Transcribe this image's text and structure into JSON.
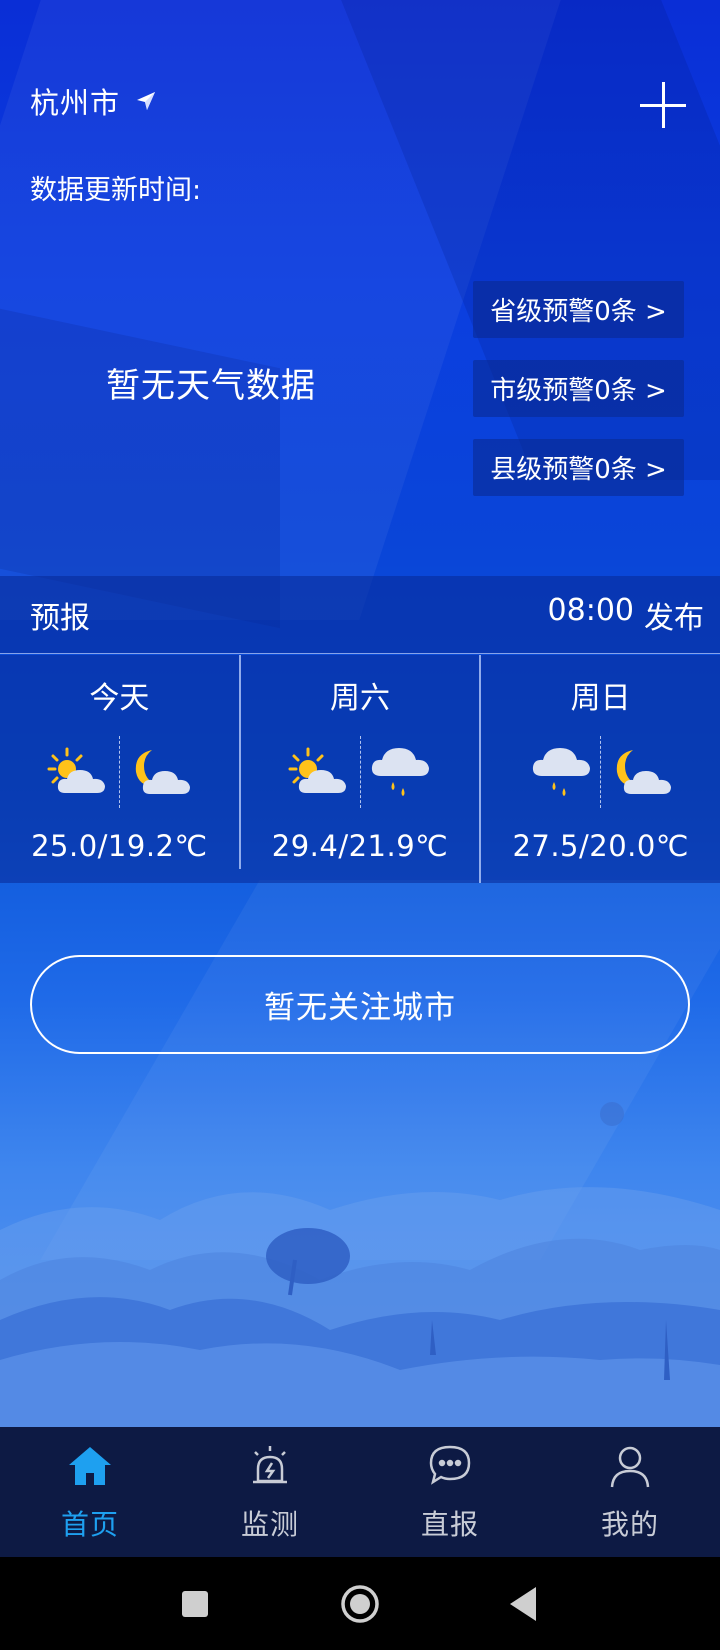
{
  "header": {
    "city": "杭州市",
    "update_label": "数据更新时间:",
    "update_value": ""
  },
  "current": {
    "no_data_text": "暂无天气数据"
  },
  "warnings": [
    {
      "label": "省级预警0条 >"
    },
    {
      "label": "市级预警0条 >"
    },
    {
      "label": "县级预警0条 >"
    }
  ],
  "forecast": {
    "title": "预报",
    "publish_time": "08:00",
    "publish_label": "发布",
    "days": [
      {
        "name": "今天",
        "day_icon": "sun-cloud-icon",
        "night_icon": "moon-cloud-icon",
        "temp": "25.0/19.2℃"
      },
      {
        "name": "周六",
        "day_icon": "sun-cloud-icon",
        "night_icon": "rain-cloud-icon",
        "temp": "29.4/21.9℃"
      },
      {
        "name": "周日",
        "day_icon": "rain-cloud-icon",
        "night_icon": "moon-cloud-icon",
        "temp": "27.5/20.0℃"
      }
    ]
  },
  "follow": {
    "label": "暂无关注城市"
  },
  "tabs": [
    {
      "label": "首页",
      "icon": "home-icon",
      "active": true
    },
    {
      "label": "监测",
      "icon": "alarm-icon",
      "active": false
    },
    {
      "label": "直报",
      "icon": "chat-icon",
      "active": false
    },
    {
      "label": "我的",
      "icon": "user-icon",
      "active": false
    }
  ],
  "colors": {
    "active_tab": "#1ea0f0",
    "inactive_tab": "#c8ccd6",
    "tabbar_bg": "#0d1a44",
    "sun": "#ffc21a"
  }
}
